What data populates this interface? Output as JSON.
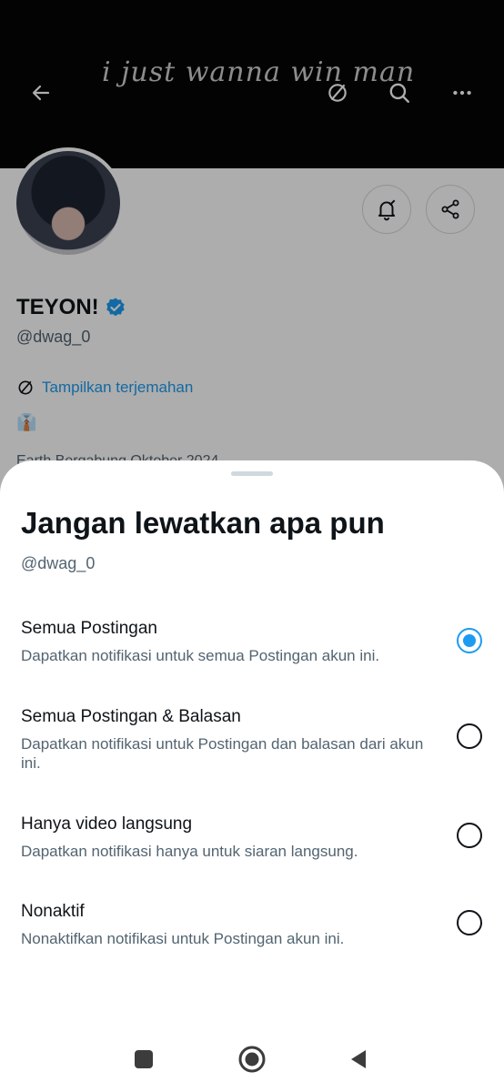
{
  "profile": {
    "banner_text": "i just wanna win man",
    "name": "TEYON!",
    "handle": "@dwag_0",
    "translate_label": "Tampilkan terjemahan",
    "bio_emoji": "👔",
    "meta_text": "Earth   Bergabung Oktober 2024"
  },
  "sheet": {
    "title": "Jangan lewatkan apa pun",
    "handle": "@dwag_0",
    "options": [
      {
        "title": "Semua Postingan",
        "desc": "Dapatkan notifikasi untuk semua Postingan akun ini.",
        "selected": true
      },
      {
        "title": "Semua Postingan & Balasan",
        "desc": "Dapatkan notifikasi untuk Postingan dan balasan dari akun ini.",
        "selected": false
      },
      {
        "title": "Hanya video langsung",
        "desc": "Dapatkan notifikasi hanya untuk siaran langsung.",
        "selected": false
      },
      {
        "title": "Nonaktif",
        "desc": "Nonaktifkan notifikasi untuk Postingan akun ini.",
        "selected": false
      }
    ]
  },
  "colors": {
    "accent": "#1d9bf0",
    "text": "#0f1419",
    "secondary": "#536471"
  },
  "icons": [
    "back-arrow-icon",
    "translate-icon",
    "search-icon",
    "more-icon",
    "bell-check-icon",
    "share-icon",
    "verified-badge-icon",
    "recents-icon",
    "home-icon",
    "back-icon"
  ]
}
